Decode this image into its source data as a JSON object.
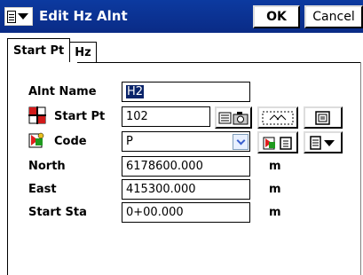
{
  "titlebar": {
    "title": "Edit Hz Alnt",
    "ok_label": "OK",
    "cancel_label": "Cancel",
    "menu_icon": "document-menu-icon",
    "color": "#0a2b86"
  },
  "tabs": [
    {
      "label": "Start Pt",
      "active": true
    },
    {
      "label": "Hz",
      "active": false
    }
  ],
  "form": {
    "alnt_name": {
      "label": "Alnt Name",
      "value": "H2"
    },
    "start_pt": {
      "label": "Start Pt",
      "value": "102"
    },
    "code": {
      "label": "Code",
      "value": "P"
    },
    "north": {
      "label": "North",
      "value": "6178600.000",
      "unit": "m"
    },
    "east": {
      "label": "East",
      "value": "415300.000",
      "unit": "m"
    },
    "start_sta": {
      "label": "Start Sta",
      "value": "0+00.000",
      "unit": "m"
    }
  },
  "icons": {
    "start_pt_icon": "crosshair-point-icon",
    "code_icon": "code-library-icon",
    "list_icon": "point-list-icon",
    "map_icon": "map-select-icon",
    "notes_icon": "notes-icon"
  }
}
